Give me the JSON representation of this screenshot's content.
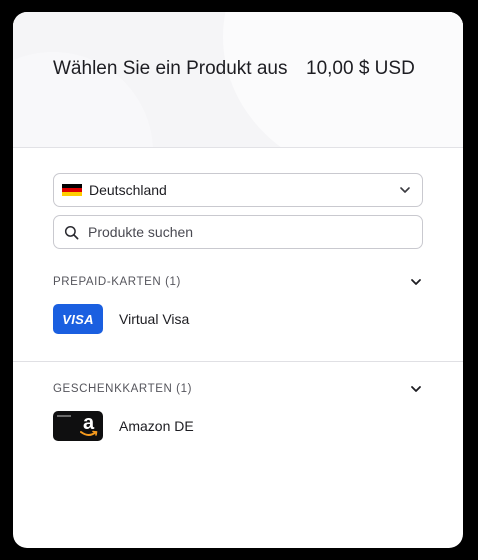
{
  "header": {
    "title": "Wählen Sie ein Produkt aus",
    "amount": "10,00 $ USD"
  },
  "country_select": {
    "selected": "Deutschland",
    "flag_icon": "germany-flag-icon"
  },
  "search": {
    "placeholder": "Produkte suchen"
  },
  "sections": [
    {
      "title": "PREPAID-KARTEN (1)",
      "items": [
        {
          "name": "Virtual Visa",
          "logo_text": "VISA",
          "logo_color": "#1a5fe0"
        }
      ]
    },
    {
      "title": "GESCHENKKARTEN (1)",
      "items": [
        {
          "name": "Amazon DE",
          "logo_text": "a",
          "logo_color": "#0f0f10"
        }
      ]
    }
  ],
  "colors": {
    "text_primary": "#1d1d22",
    "text_secondary": "#55555c",
    "border": "#c9c9cf",
    "visa_blue": "#1a5fe0",
    "amazon_orange": "#f59a1e"
  }
}
